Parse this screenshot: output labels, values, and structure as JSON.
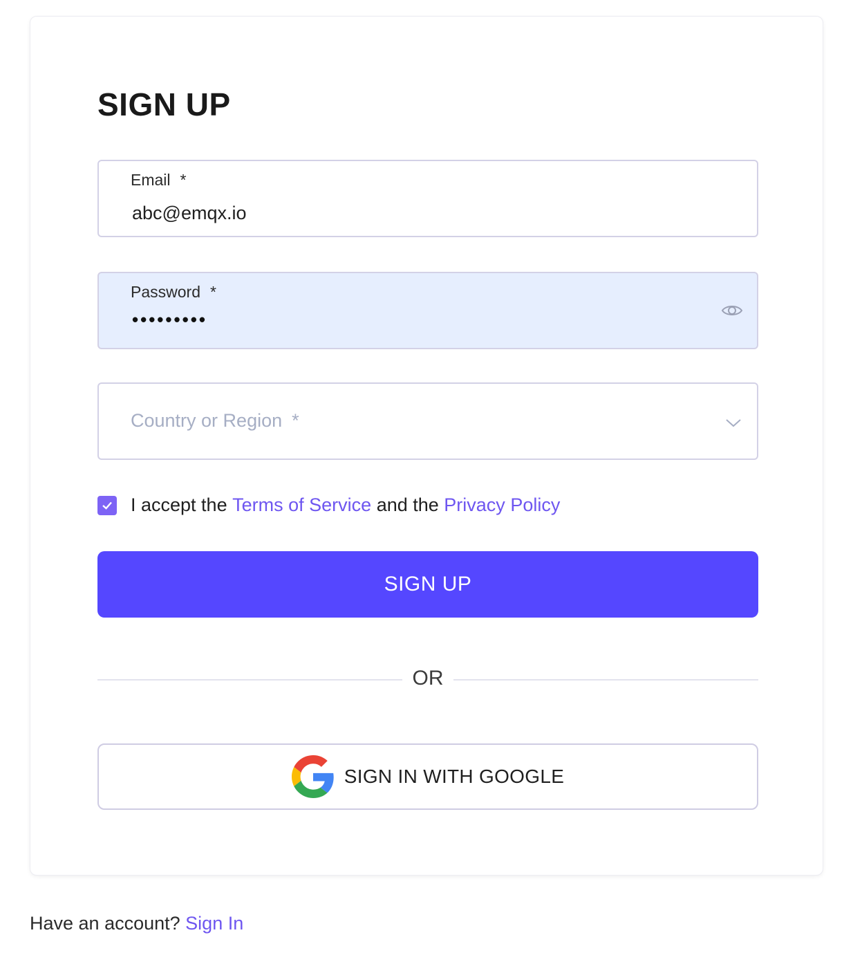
{
  "form": {
    "title": "SIGN UP",
    "email": {
      "label": "Email",
      "required_mark": "*",
      "value": "abc@emqx.io"
    },
    "password": {
      "label": "Password",
      "required_mark": "*",
      "masked_value": "•••••••••",
      "toggle_icon": "eye-icon"
    },
    "country": {
      "placeholder": "Country or Region",
      "required_mark": "*",
      "dropdown_icon": "chevron-down-icon"
    },
    "consent": {
      "checked": true,
      "prefix": "I accept the",
      "terms_link": "Terms of Service",
      "middle": "and the",
      "privacy_link": "Privacy Policy"
    },
    "submit_label": "SIGN UP",
    "divider_text": "OR",
    "google_label": "SIGN IN WITH GOOGLE"
  },
  "footer": {
    "prompt": "Have an account?",
    "signin_link": "Sign In"
  },
  "colors": {
    "primary": "#5547ff",
    "link": "#6e56f0",
    "checkbox": "#7d63f5",
    "password_bg": "#e6eefe",
    "placeholder": "#a6aec4",
    "field_border": "#d3d1e6"
  }
}
